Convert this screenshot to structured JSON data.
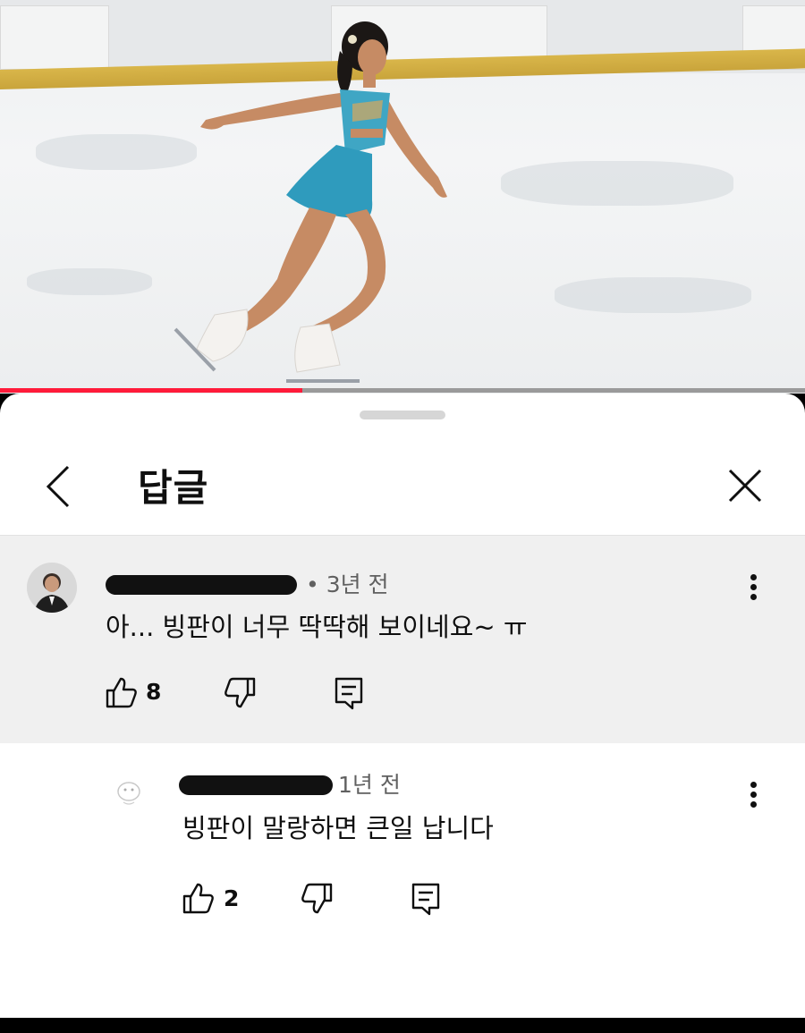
{
  "video": {
    "banner_left": "",
    "banner_right": "",
    "progress": 0.375,
    "progress_color": "#ff1b3a"
  },
  "sheet": {
    "title": "답글",
    "back_icon": "chevron-left-icon",
    "close_icon": "close-icon"
  },
  "comment": {
    "time": "• 3년 전",
    "text": "아... 빙판이 너무 딱딱해 보이네요~ ㅠ",
    "likes": "8",
    "like_icon": "thumbs-up-icon",
    "dislike_icon": "thumbs-down-icon",
    "reply_icon": "reply-icon",
    "more_icon": "more-vertical-icon"
  },
  "reply": {
    "time": "1년 전",
    "text": "빙판이 말랑하면 큰일 납니다",
    "likes": "2"
  },
  "colors": {
    "accent": "#ff1b3a",
    "comment_bg": "#f0f0f0",
    "text": "#0f0f0f",
    "meta": "#606060"
  }
}
